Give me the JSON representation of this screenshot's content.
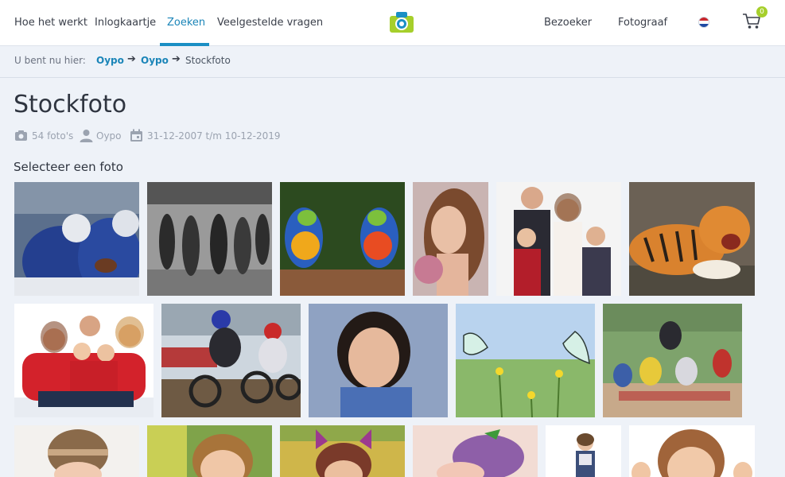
{
  "nav": {
    "items": [
      "Hoe het werkt",
      "Inlogkaartje",
      "Zoeken",
      "Veelgestelde vragen"
    ],
    "right": [
      "Bezoeker",
      "Fotograaf"
    ],
    "cart_count": "0",
    "accent": "#1b8fc4",
    "badge_color": "#a6cf2b"
  },
  "breadcrumb": {
    "label": "U bent nu hier:",
    "links": [
      "Oypo",
      "Oypo"
    ],
    "current": "Stockfoto"
  },
  "page": {
    "title": "Stockfoto",
    "photo_count": "54 foto's",
    "owner": "Oypo",
    "date_range": "31-12-2007 t/m 10-12-2019",
    "section_title": "Selecteer een foto"
  },
  "icons": [
    "camera-icon",
    "user-icon",
    "calendar-icon",
    "cart-icon",
    "flag-nl-icon",
    "arrow-right-icon"
  ],
  "photos": [
    "american-football",
    "sprinters",
    "parrots",
    "girl-portrait",
    "family-portrait",
    "tiger",
    "family-red",
    "motocross-riders",
    "curly-child",
    "butterflies",
    "motocross-race",
    "baby-hat",
    "girl-pigtails",
    "girl-bow",
    "baby-flower-hat",
    "toddler-standing",
    "girl-hands"
  ]
}
